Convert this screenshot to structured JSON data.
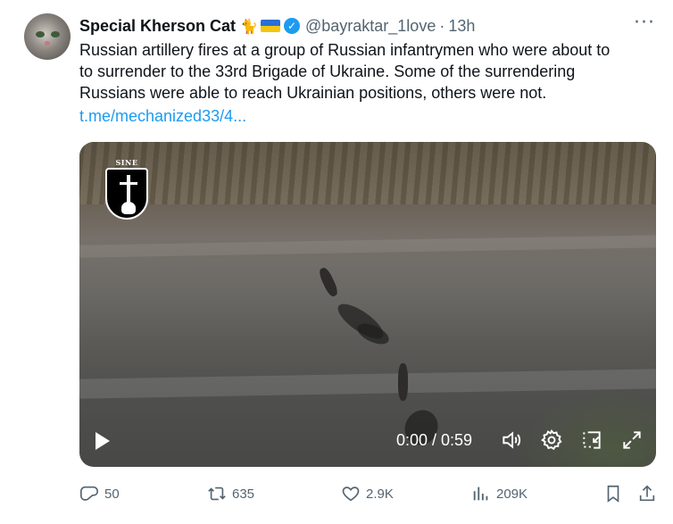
{
  "author": {
    "display_name": "Special Kherson Cat",
    "emoji": "🐈",
    "handle": "@bayraktar_1love",
    "separator": "·",
    "time": "13h"
  },
  "menu": {
    "more_label": "···"
  },
  "tweet": {
    "lines": [
      "Russian artillery fires at a group of Russian infantrymen who were about to",
      "to surrender to the 33rd Brigade of Ukraine. Some of the surrendering",
      "Russians were able to reach Ukrainian positions, others were not."
    ],
    "link_text": "t.me/mechanized33/4..."
  },
  "video": {
    "insignia_text": "SINE METU",
    "timecode": "0:00 / 0:59",
    "icons": [
      "play-icon",
      "volume-icon",
      "settings-icon",
      "dock-icon",
      "fullscreen-icon"
    ]
  },
  "actions": {
    "replies": "50",
    "reposts": "635",
    "likes": "2.9K",
    "views": "209K"
  },
  "colors": {
    "link": "#1d9bf0",
    "secondary_text": "#536471",
    "verified": "#1d9bf0"
  }
}
